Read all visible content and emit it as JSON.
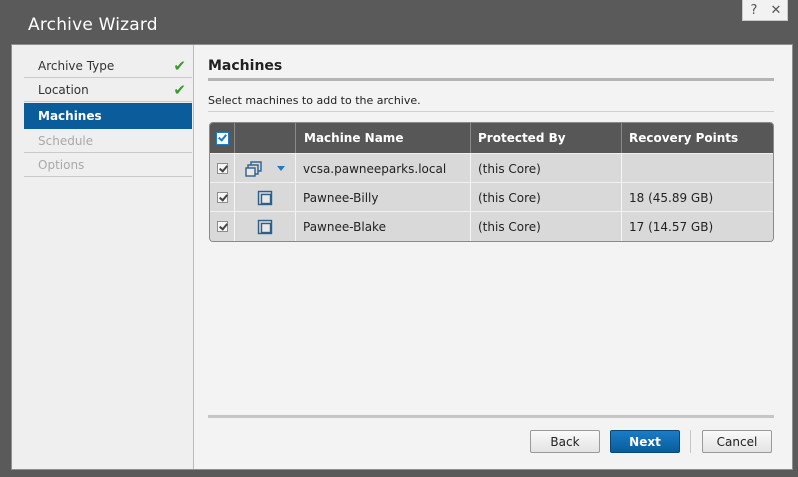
{
  "window": {
    "title": "Archive Wizard",
    "help_label": "?",
    "close_label": "✕"
  },
  "nav": {
    "items": [
      {
        "label": "Archive Type",
        "state": "done"
      },
      {
        "label": "Location",
        "state": "done"
      },
      {
        "label": "Machines",
        "state": "active"
      },
      {
        "label": "Schedule",
        "state": "disabled"
      },
      {
        "label": "Options",
        "state": "disabled"
      }
    ],
    "check_glyph": "✔"
  },
  "content": {
    "heading": "Machines",
    "subtitle": "Select machines to add to the archive."
  },
  "grid": {
    "columns": [
      "Machine Name",
      "Protected By",
      "Recovery Points"
    ],
    "rows": [
      {
        "name": "vcsa.pawneeparks.local",
        "protected_by": "(this Core)",
        "recovery_points": "",
        "icon": "vcenter-server-icon",
        "has_dropdown": true,
        "checked": true
      },
      {
        "name": "Pawnee-Billy",
        "protected_by": "(this Core)",
        "recovery_points": "18 (45.89 GB)",
        "icon": "virtual-machine-icon",
        "has_dropdown": false,
        "checked": true
      },
      {
        "name": "Pawnee-Blake",
        "protected_by": "(this Core)",
        "recovery_points": "17 (14.57 GB)",
        "icon": "virtual-machine-icon",
        "has_dropdown": false,
        "checked": true
      }
    ]
  },
  "buttons": {
    "back": "Back",
    "next": "Next",
    "cancel": "Cancel"
  },
  "colors": {
    "accent": "#0a5d9a",
    "check_green": "#3b9c2e",
    "grid_header": "#575757"
  }
}
